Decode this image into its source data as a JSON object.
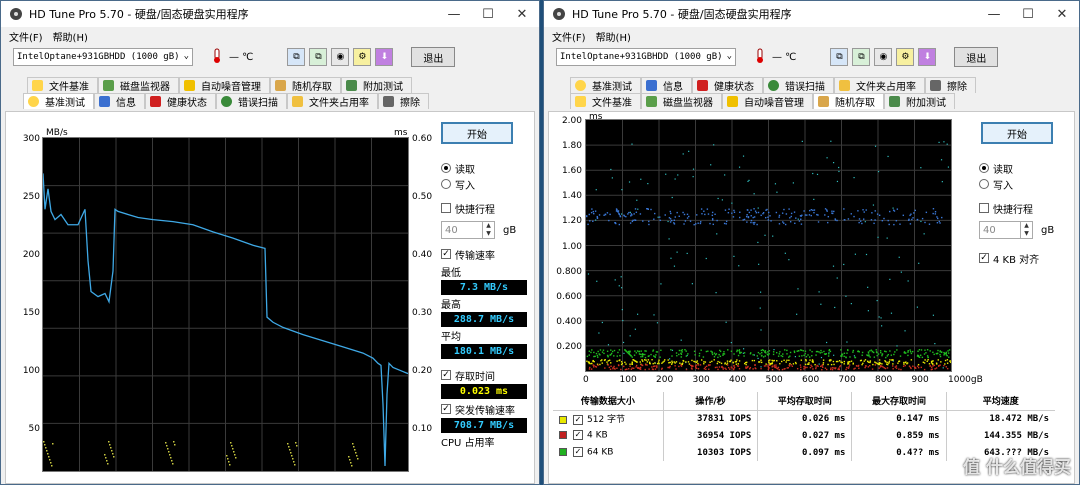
{
  "left": {
    "title": "HD Tune Pro 5.70 - 硬盘/固态硬盘实用程序",
    "menu": [
      "文件(F)",
      "帮助(H)"
    ],
    "drive": "IntelOptane+931GBHDD (1000 gB)",
    "temp": "— ℃",
    "exit": "退出",
    "tabs_back": [
      "文件基准",
      "磁盘监视器",
      "自动噪音管理",
      "随机存取",
      "附加测试"
    ],
    "tabs_front": [
      "基准测试",
      "信息",
      "健康状态",
      "错误扫描",
      "文件夹占用率",
      "擦除"
    ],
    "active_tab": "基准测试",
    "chart": {
      "left_unit": "MB/s",
      "right_unit": "ms",
      "left_ticks": [
        "300",
        "250",
        "200",
        "150",
        "100",
        "50"
      ],
      "right_ticks": [
        "0.60",
        "0.50",
        "0.40",
        "0.30",
        "0.20",
        "0.10"
      ]
    },
    "controls": {
      "start": "开始",
      "read": "读取",
      "write": "写入",
      "short_stroke": "快捷行程",
      "spin_value": "40",
      "spin_unit": "gB",
      "transfer_rate": "传输速率",
      "min_label": "最低",
      "min_value": "7.3 MB/s",
      "max_label": "最高",
      "max_value": "288.7 MB/s",
      "avg_label": "平均",
      "avg_value": "180.1 MB/s",
      "access_time": "存取时间",
      "access_value": "0.023 ms",
      "burst_rate": "突发传输速率",
      "burst_value": "708.7 MB/s",
      "cpu_label": "CPU 占用率"
    }
  },
  "right": {
    "title": "HD Tune Pro 5.70 - 硬盘/固态硬盘实用程序",
    "menu": [
      "文件(F)",
      "帮助(H)"
    ],
    "drive": "IntelOptane+931GBHDD (1000 gB)",
    "temp": "— ℃",
    "exit": "退出",
    "tabs_back": [
      "基准测试",
      "信息",
      "健康状态",
      "错误扫描",
      "文件夹占用率",
      "擦除"
    ],
    "tabs_front": [
      "文件基准",
      "磁盘监视器",
      "自动噪音管理",
      "随机存取",
      "附加测试"
    ],
    "active_tab": "随机存取",
    "chart": {
      "y_unit": "ms",
      "y_ticks": [
        "2.00",
        "1.80",
        "1.60",
        "1.40",
        "1.20",
        "1.00",
        "0.800",
        "0.600",
        "0.400",
        "0.200"
      ],
      "x_ticks": [
        "0",
        "100",
        "200",
        "300",
        "400",
        "500",
        "600",
        "700",
        "800",
        "900",
        "1000gB"
      ]
    },
    "controls": {
      "start": "开始",
      "read": "读取",
      "write": "写入",
      "short_stroke": "快捷行程",
      "spin_value": "40",
      "spin_unit": "gB",
      "align": "4 KB 对齐"
    },
    "table": {
      "headers": [
        "传输数据大小",
        "操作/秒",
        "平均存取时间",
        "最大存取时间",
        "平均速度"
      ],
      "rows": [
        {
          "size": "512 字节",
          "color": "#e8e800",
          "ops": "37831 IOPS",
          "avg": "0.026 ms",
          "max": "0.147 ms",
          "speed": "18.472 MB/s"
        },
        {
          "size": "4 KB",
          "color": "#c02020",
          "ops": "36954 IOPS",
          "avg": "0.027 ms",
          "max": "0.859 ms",
          "speed": "144.355 MB/s"
        },
        {
          "size": "64 KB",
          "color": "#20b020",
          "ops": "10303 IOPS",
          "avg": "0.097 ms",
          "max": "0.4?? ms",
          "speed": "643.??? MB/s"
        }
      ]
    }
  },
  "watermark": "值 什么值得买",
  "colors": {
    "curve": "#3fa9e6",
    "plot_bg": "#000000",
    "grid": "#3a3a3a"
  }
}
